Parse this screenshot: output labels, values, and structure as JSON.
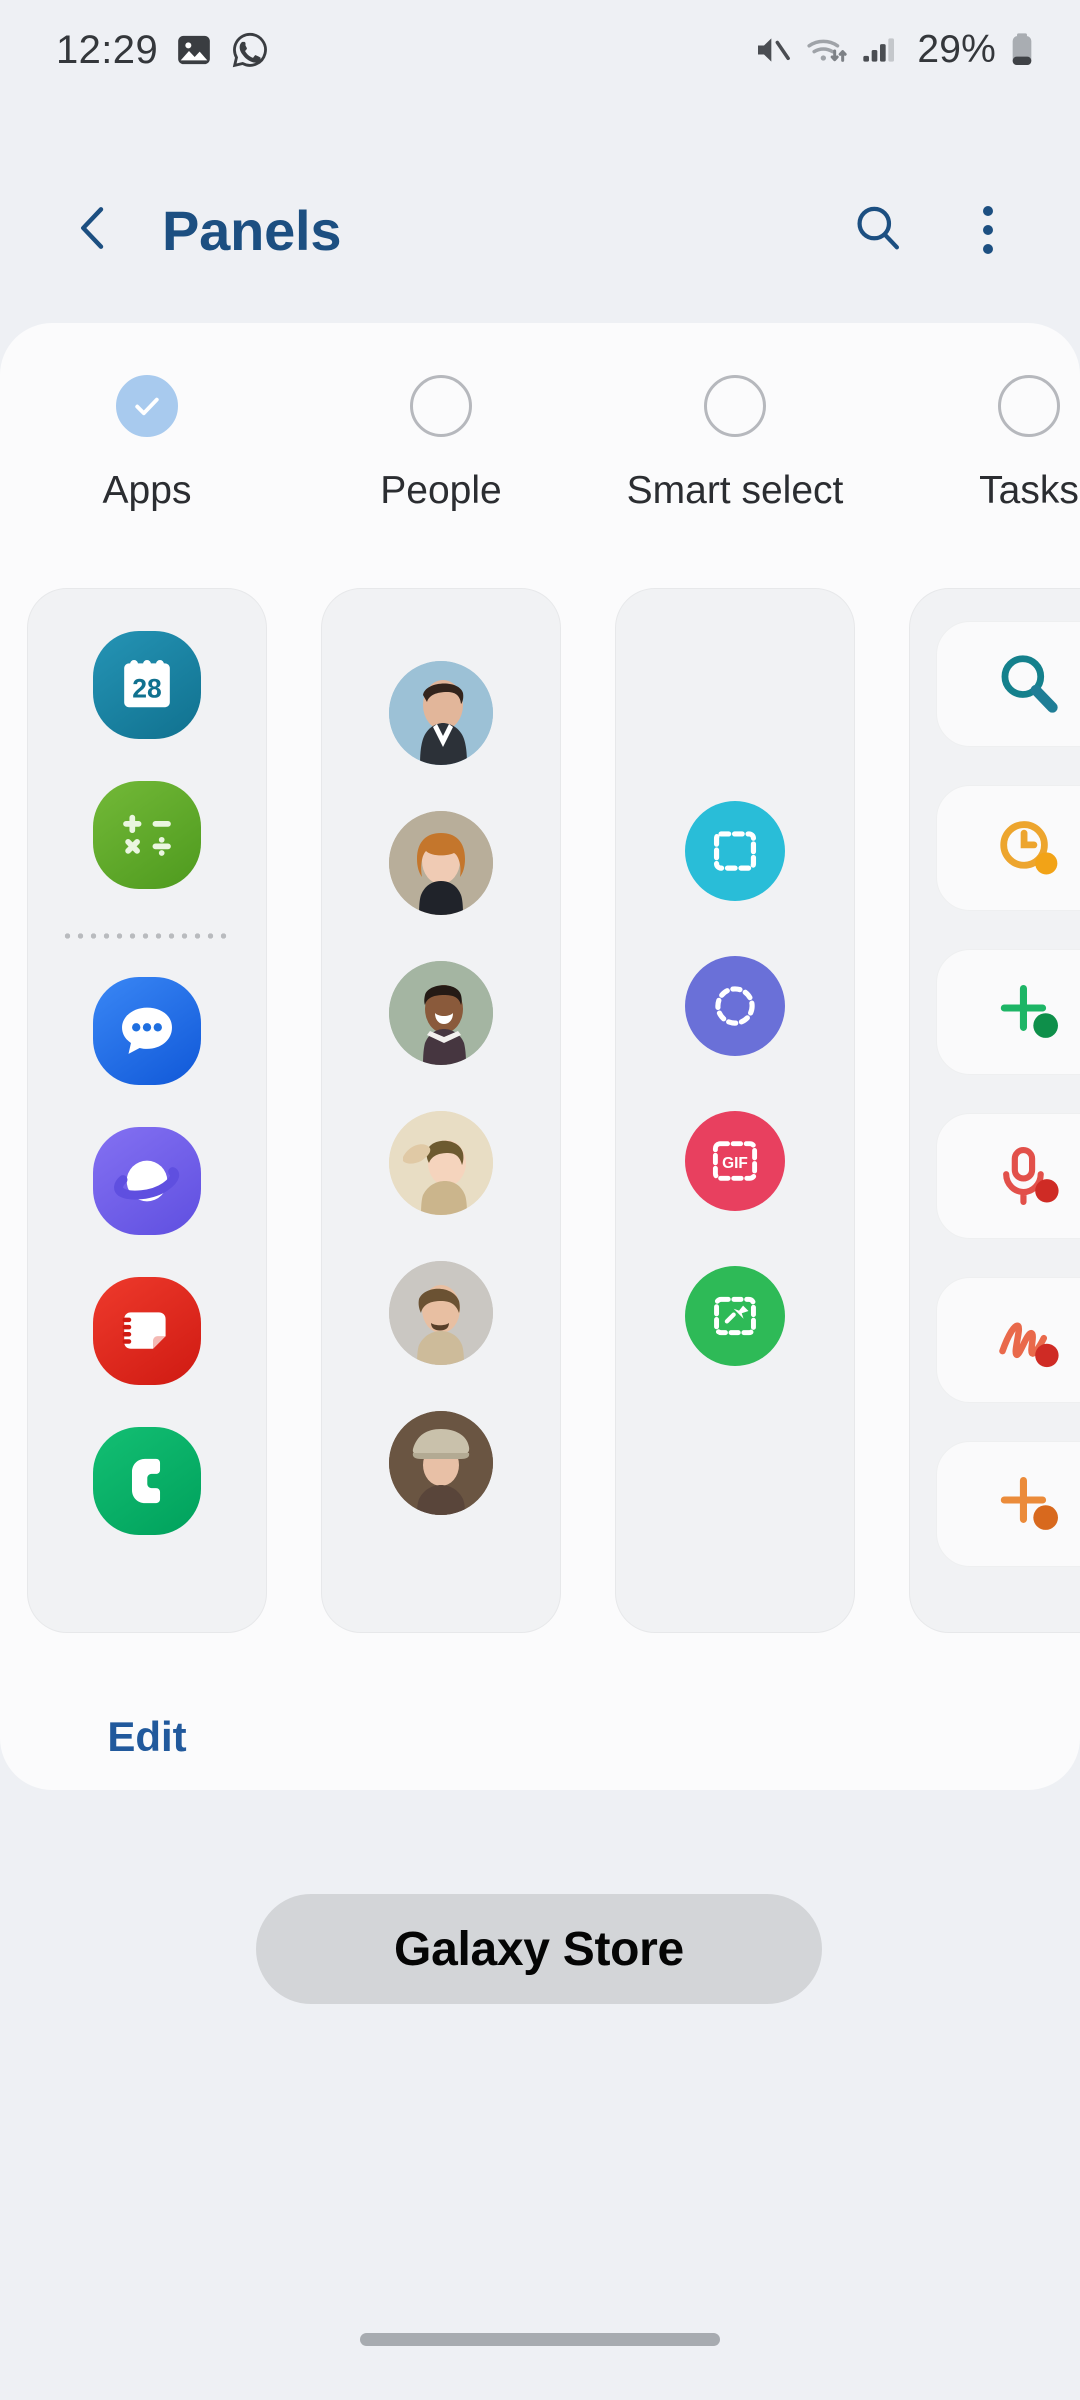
{
  "status_bar": {
    "time": "12:29",
    "battery_percent": "29%",
    "left_icons": [
      "gallery-icon",
      "whatsapp-icon"
    ],
    "right_icons": [
      "mute-icon",
      "wifi-icon",
      "signal-icon",
      "battery-icon"
    ],
    "signal_bars_filled": 3,
    "battery_level": 29
  },
  "app_bar": {
    "back_label": "back-chevron-icon",
    "title": "Panels",
    "search_label": "search-icon",
    "more_label": "more-options-icon"
  },
  "chooser": {
    "items": [
      {
        "label": "Apps",
        "selected": true
      },
      {
        "label": "People",
        "selected": false
      },
      {
        "label": "Smart select",
        "selected": false
      },
      {
        "label": "Tasks",
        "selected": false
      }
    ]
  },
  "panels": {
    "apps": {
      "icons": [
        {
          "name": "calendar-icon",
          "label": "28",
          "color": "#1b7898"
        },
        {
          "name": "calculator-icon",
          "label": "+ - x /",
          "color": "#56a524"
        },
        {
          "name": "divider",
          "label": "",
          "color": ""
        },
        {
          "name": "messages-icon",
          "label": "",
          "color": "#1a73e8"
        },
        {
          "name": "samsung-internet-icon",
          "label": "",
          "color": "#6a5de8"
        },
        {
          "name": "samsung-notes-icon",
          "label": "",
          "color": "#e02b20"
        },
        {
          "name": "phone-icon",
          "label": "",
          "color": "#00a862"
        }
      ]
    },
    "people": {
      "contacts": [
        {
          "name": "contact-avatar-1",
          "bg": "#9cc1d6",
          "hair": "#35261d",
          "skin": "#e2b69a"
        },
        {
          "name": "contact-avatar-2",
          "bg": "#b8ae9a",
          "hair": "#c06f2a",
          "skin": "#f0cbb4"
        },
        {
          "name": "contact-avatar-3",
          "bg": "#a4b5a2",
          "hair": "#241a15",
          "skin": "#8a5a3b"
        },
        {
          "name": "contact-avatar-4",
          "bg": "#e8ddc4",
          "hair": "#6d5a30",
          "skin": "#f5d4bd"
        },
        {
          "name": "contact-avatar-5",
          "bg": "#cac7c2",
          "hair": "#6b5233",
          "skin": "#e8bfa2"
        },
        {
          "name": "contact-avatar-6",
          "bg": "#6a5542",
          "hair": "#c9c1ab",
          "skin": "#e8c0a6"
        }
      ]
    },
    "smart_select": {
      "tools": [
        {
          "name": "rectangle-select-icon",
          "color": "#29bdd8"
        },
        {
          "name": "oval-select-icon",
          "color": "#6a70d8"
        },
        {
          "name": "gif-capture-icon",
          "color": "#e8405f",
          "label": "GIF"
        },
        {
          "name": "pin-to-screen-icon",
          "color": "#2eba57"
        }
      ]
    },
    "tasks": {
      "tools": [
        {
          "name": "search-task-icon",
          "color": "#14808c"
        },
        {
          "name": "alarm-task-icon",
          "color": "#eda52e"
        },
        {
          "name": "add-event-icon",
          "color": "#1db566"
        },
        {
          "name": "voice-record-icon",
          "color": "#e2504a"
        },
        {
          "name": "handwriting-icon",
          "color": "#e9694b"
        },
        {
          "name": "add-note-icon",
          "color": "#eb8b3a"
        }
      ]
    },
    "edit_label": "Edit"
  },
  "store_button": {
    "label": "Galaxy Store"
  },
  "nav_bar": {
    "handle": "gesture-handle"
  },
  "colors": {
    "background": "#eef0f4",
    "card": "#fbfbfc",
    "panel": "#f1f2f4",
    "accent_blue": "#1c4f81",
    "link_blue": "#21599c",
    "checked_circle": "#a8caee",
    "store_bg": "#d3d5d8"
  }
}
